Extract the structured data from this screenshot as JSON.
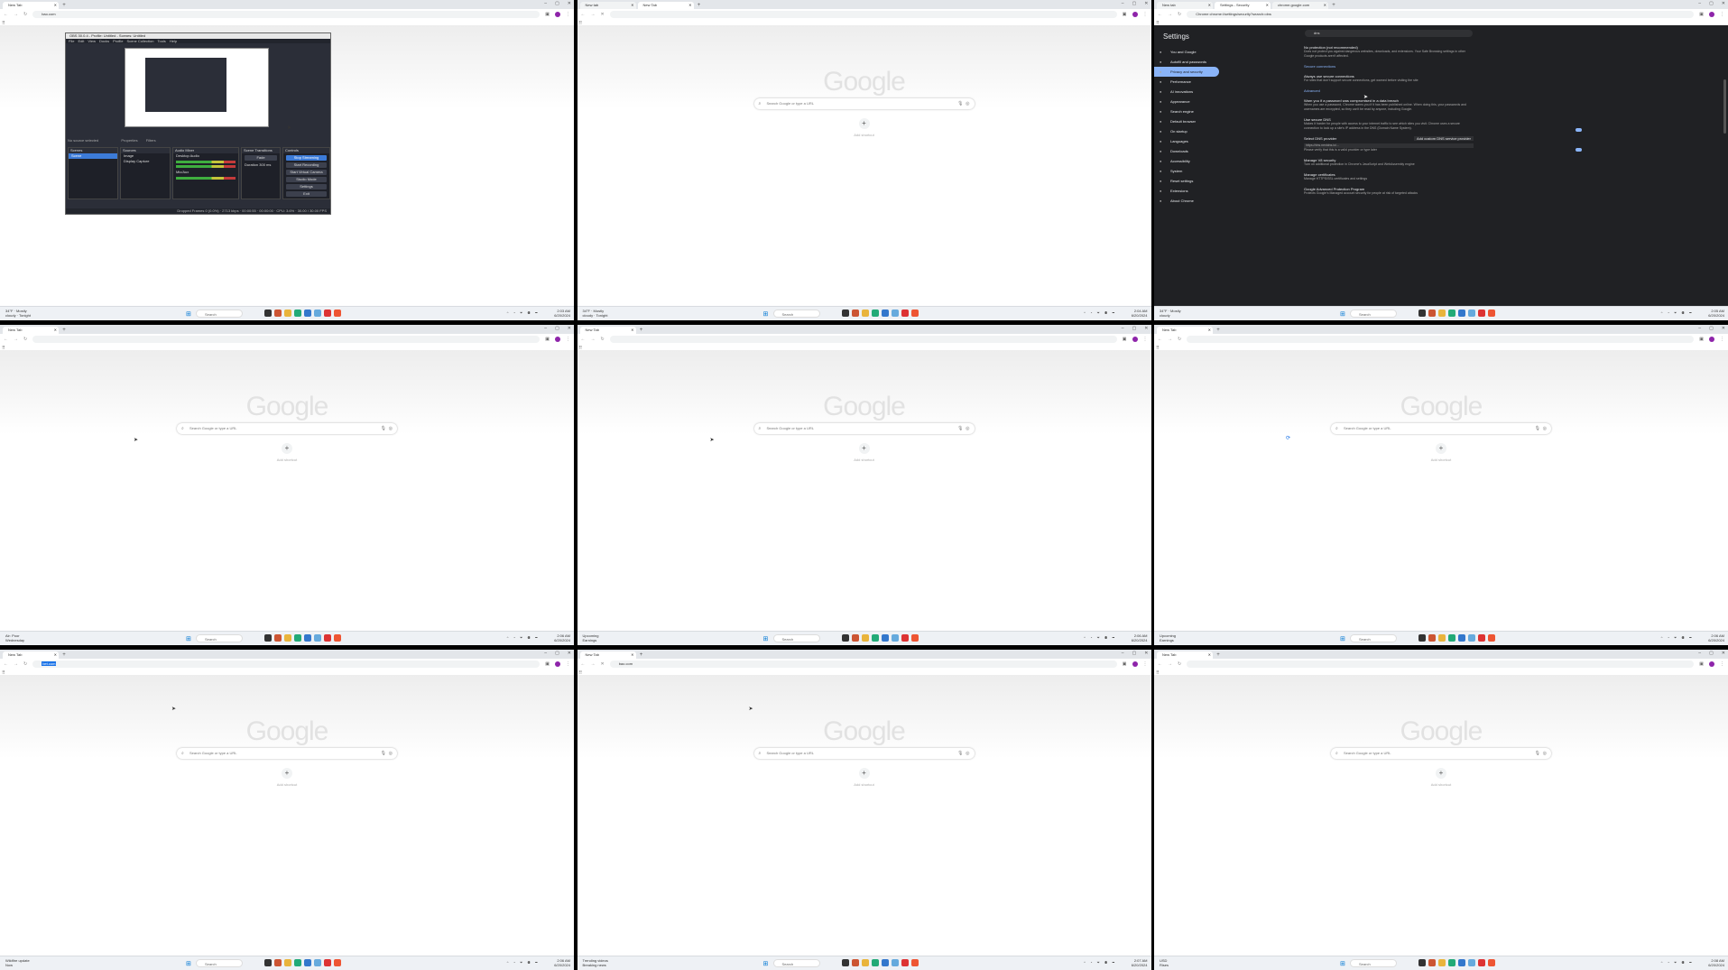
{
  "google": {
    "logo": "Google",
    "search_placeholder": "Search Google or type a URL",
    "add_shortcut_label": "Add shortcut"
  },
  "taskbar": {
    "search_label": "Search"
  },
  "panels": [
    {
      "tab": "New Tab",
      "url": "bao.com",
      "weather_line1": "34°F · Mostly",
      "weather_line2": "cloudy · Tonight",
      "clock_time": "2:03 AM",
      "clock_date": "6/20/2024",
      "obs": {
        "title": "OBS 30.0.4 - Profile: Untitled - Scenes: Untitled",
        "menu": [
          "File",
          "Edit",
          "View",
          "Docks",
          "Profile",
          "Scene Collection",
          "Tools",
          "Help"
        ],
        "no_source": "No source selected",
        "properties": "Properties",
        "filters": "Filters",
        "scenes_header": "Scenes",
        "scene_item": "Scene",
        "sources_header": "Sources",
        "sources": [
          "Image",
          "Display Capture"
        ],
        "mixer_header": "Audio Mixer",
        "mixer": [
          "Desktop Audio",
          "Mic/Aux"
        ],
        "transitions_header": "Scene Transitions",
        "transition": "Fade",
        "duration_label": "Duration",
        "duration_value": "300 ms",
        "controls_header": "Controls",
        "controls": [
          "Stop Streaming",
          "Start Recording",
          "Start Virtual Camera",
          "Studio Mode",
          "Settings",
          "Exit"
        ],
        "status": "Dropped Frames 0 (0.0%) · 2713 kbps · 00:00:55 · 00:00:00 · CPU: 3.6% · 30.00 / 30.00 FPS"
      }
    },
    {
      "tabs": [
        "New tab",
        "New Tab"
      ],
      "url": "",
      "weather_line1": "34°F · Mostly",
      "weather_line2": "cloudy · Tonight",
      "clock_time": "2:04 AM",
      "clock_date": "6/20/2024"
    },
    {
      "tabs": [
        "New tab",
        "Settings - Security",
        "chrome.google.com"
      ],
      "url": "Chrome  chrome://settings/security?search=dns",
      "weather_line1": "34°F · Mostly",
      "weather_line2": "cloudy",
      "clock_time": "2:05 AM",
      "clock_date": "6/20/2024",
      "settings": {
        "title": "Settings",
        "search": "dns",
        "nav": [
          "You and Google",
          "Autofill and passwords",
          "Privacy and security",
          "Performance",
          "AI innovations",
          "Appearance",
          "Search engine",
          "Default browser",
          "On startup",
          "Languages",
          "Downloads",
          "Accessibility",
          "System",
          "Reset settings",
          "Extensions",
          "About Chrome"
        ],
        "no_protection_title": "No protection (not recommended)",
        "no_protection_desc": "Does not protect you against dangerous websites, downloads, and extensions. Your Safe Browsing settings in other Google products aren't affected.",
        "secure_connections": "Secure connections",
        "always_secure_title": "Always use secure connections",
        "always_secure_desc": "For sites that don't support secure connections, get warned before visiting the site",
        "advanced": "Advanced",
        "warn_password_title": "Warn you if a password was compromised in a data breach",
        "warn_password_desc": "When you use a password, Chrome warns you if it has been published online. When doing this, your passwords and usernames are encrypted, so they can't be read by anyone, including Google.",
        "use_secure_dns_title": "Use secure DNS",
        "use_secure_dns_desc": "Makes it harder for people with access to your internet traffic to see which sites you visit. Chrome uses a secure connection to look up a site's IP address in the DNS (Domain Name System).",
        "select_provider": "Select DNS provider",
        "provider_value": "Add custom DNS service provider",
        "provider_url": "https://dns.nextdns.io/...",
        "provider_note": "Please verify that this is a valid provider or type later",
        "manage_v8_title": "Manage V8 security",
        "manage_v8_desc": "Turn on additional protection in Chrome's JavaScript and WebAssembly engine",
        "manage_certs_title": "Manage certificates",
        "manage_certs_desc": "Manage HTTPS/SSL certificates and settings",
        "gapp_title": "Google Advanced Protection Program",
        "gapp_desc": "Protects Google's Managed account security for people at risk of targeted attacks"
      }
    },
    {
      "tab": "New Tab",
      "url": "",
      "weather_line1": "Air: Poor",
      "weather_line2": "Wednesday",
      "clock_time": "2:06 AM",
      "clock_date": "6/20/2024"
    },
    {
      "tab": "New Tab",
      "url": "",
      "weather_line1": "Upcoming",
      "weather_line2": "Earnings",
      "clock_time": "2:06 AM",
      "clock_date": "6/20/2024"
    },
    {
      "tab": "New Tab",
      "url": "",
      "weather_line1": "Upcoming",
      "weather_line2": "Earnings",
      "clock_time": "2:06 AM",
      "clock_date": "6/20/2024"
    },
    {
      "tab": "New Tab",
      "url": "bet.com",
      "weather_line1": "Wildfire update",
      "weather_line2": "Now",
      "clock_time": "2:06 AM",
      "clock_date": "6/20/2024"
    },
    {
      "tab": "New Tab",
      "url": "bao.com",
      "weather_line1": "Trending videos",
      "weather_line2": "Breaking news",
      "clock_time": "2:07 AM",
      "clock_date": "6/20/2024"
    },
    {
      "tab": "New Tab",
      "url": "",
      "weather_line1": "USD",
      "weather_line2": "Rises",
      "clock_time": "2:08 AM",
      "clock_date": "6/20/2024"
    }
  ]
}
